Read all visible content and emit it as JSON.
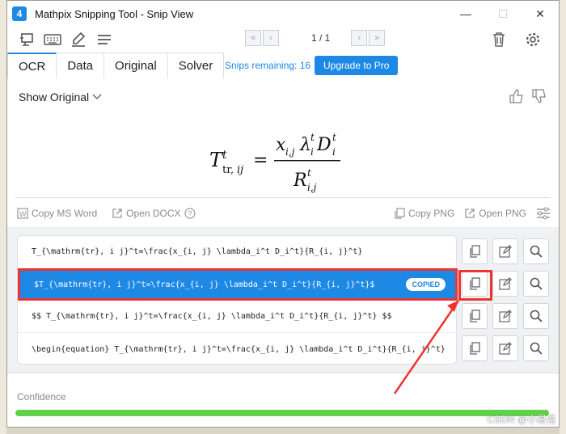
{
  "window": {
    "title": "Mathpix Snipping Tool - Snip View"
  },
  "pager": {
    "text": "1 / 1"
  },
  "tabs": [
    "OCR",
    "Data",
    "Original",
    "Solver"
  ],
  "snips_remaining": "Snips remaining: 16",
  "upgrade_label": "Upgrade to Pro",
  "show_original": "Show Original",
  "actions": {
    "copy_ms_word": "Copy MS Word",
    "open_docx": "Open DOCX",
    "copy_png": "Copy PNG",
    "open_png": "Open PNG"
  },
  "results": [
    {
      "text": "T_{\\mathrm{tr}, i j}^t=\\frac{x_{i, j} \\lambda_i^t D_i^t}{R_{i, j}^t}"
    },
    {
      "text": "$T_{\\mathrm{tr}, i j}^t=\\frac{x_{i, j} \\lambda_i^t D_i^t}{R_{i, j}^t}$",
      "badge": "COPIED"
    },
    {
      "text": "$$  T_{\\mathrm{tr}, i j}^t=\\frac{x_{i, j} \\lambda_i^t D_i^t}{R_{i, j}^t}  $$"
    },
    {
      "text": "\\begin{equation}  T_{\\mathrm{tr}, i j}^t=\\frac{x_{i, j} \\lambda_i^t D_i^t}{R_{i, j}^t}"
    }
  ],
  "confidence": {
    "label": "Confidence",
    "value": 1.0
  },
  "watermark": "CSDN @小易吾",
  "colors": {
    "accent": "#1e88e5",
    "highlight": "#e33333",
    "confidence": "#5fd14a"
  },
  "icons": [
    "app-logo-icon",
    "screen-snip-icon",
    "keyboard-icon",
    "handwriting-icon",
    "menu-icon",
    "first-page-icon",
    "prev-page-icon",
    "next-page-icon",
    "last-page-icon",
    "trash-icon",
    "gear-icon",
    "chevron-down-icon",
    "thumbs-up-icon",
    "thumbs-down-icon",
    "word-icon",
    "open-external-icon",
    "help-icon",
    "copy-icon",
    "edit-icon",
    "search-icon",
    "settings-sliders-icon"
  ]
}
